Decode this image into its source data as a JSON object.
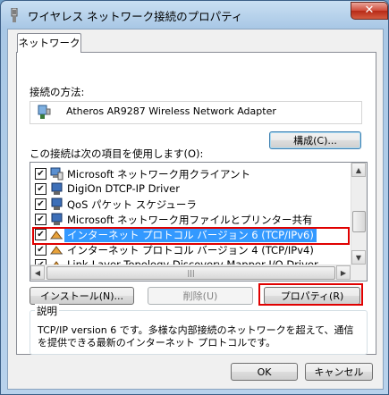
{
  "window": {
    "title": "ワイヤレス ネットワーク接続のプロパティ",
    "close_label": "✕"
  },
  "tab": {
    "label": "ネットワーク"
  },
  "connection": {
    "label": "接続の方法:",
    "adapter_name": "Atheros AR9287 Wireless Network Adapter",
    "configure_label": "構成(C)..."
  },
  "items": {
    "label": "この接続は次の項目を使用します(O):",
    "rows": [
      {
        "label": "Microsoft ネットワーク用クライアント",
        "checked": "✔",
        "icon": "network-client-icon"
      },
      {
        "label": "DigiOn DTCP-IP Driver",
        "checked": "✔",
        "icon": "network-service-icon"
      },
      {
        "label": "QoS パケット スケジューラ",
        "checked": "✔",
        "icon": "network-service-icon"
      },
      {
        "label": "Microsoft ネットワーク用ファイルとプリンター共有",
        "checked": "✔",
        "icon": "network-service-icon"
      },
      {
        "label": "インターネット プロトコル バージョン 6 (TCP/IPv6)",
        "checked": "✔",
        "icon": "protocol-icon"
      },
      {
        "label": "インターネット プロトコル バージョン 4 (TCP/IPv4)",
        "checked": "✔",
        "icon": "protocol-icon"
      },
      {
        "label": "Link-Layer Topology Discovery Mapper I/O Driver",
        "checked": "✔",
        "icon": "protocol-icon"
      }
    ]
  },
  "buttons": {
    "install": "インストール(N)...",
    "uninstall": "削除(U)",
    "properties": "プロパティ(R)",
    "ok": "OK",
    "cancel": "キャンセル"
  },
  "description": {
    "legend": "説明",
    "line1": "TCP/IP version 6 です。多様な内部接続のネットワークを超えて、通信",
    "line2": "を提供できる最新のインターネット プロトコルです。"
  },
  "colors": {
    "highlight": "#e00000",
    "selection": "#3399ff"
  }
}
